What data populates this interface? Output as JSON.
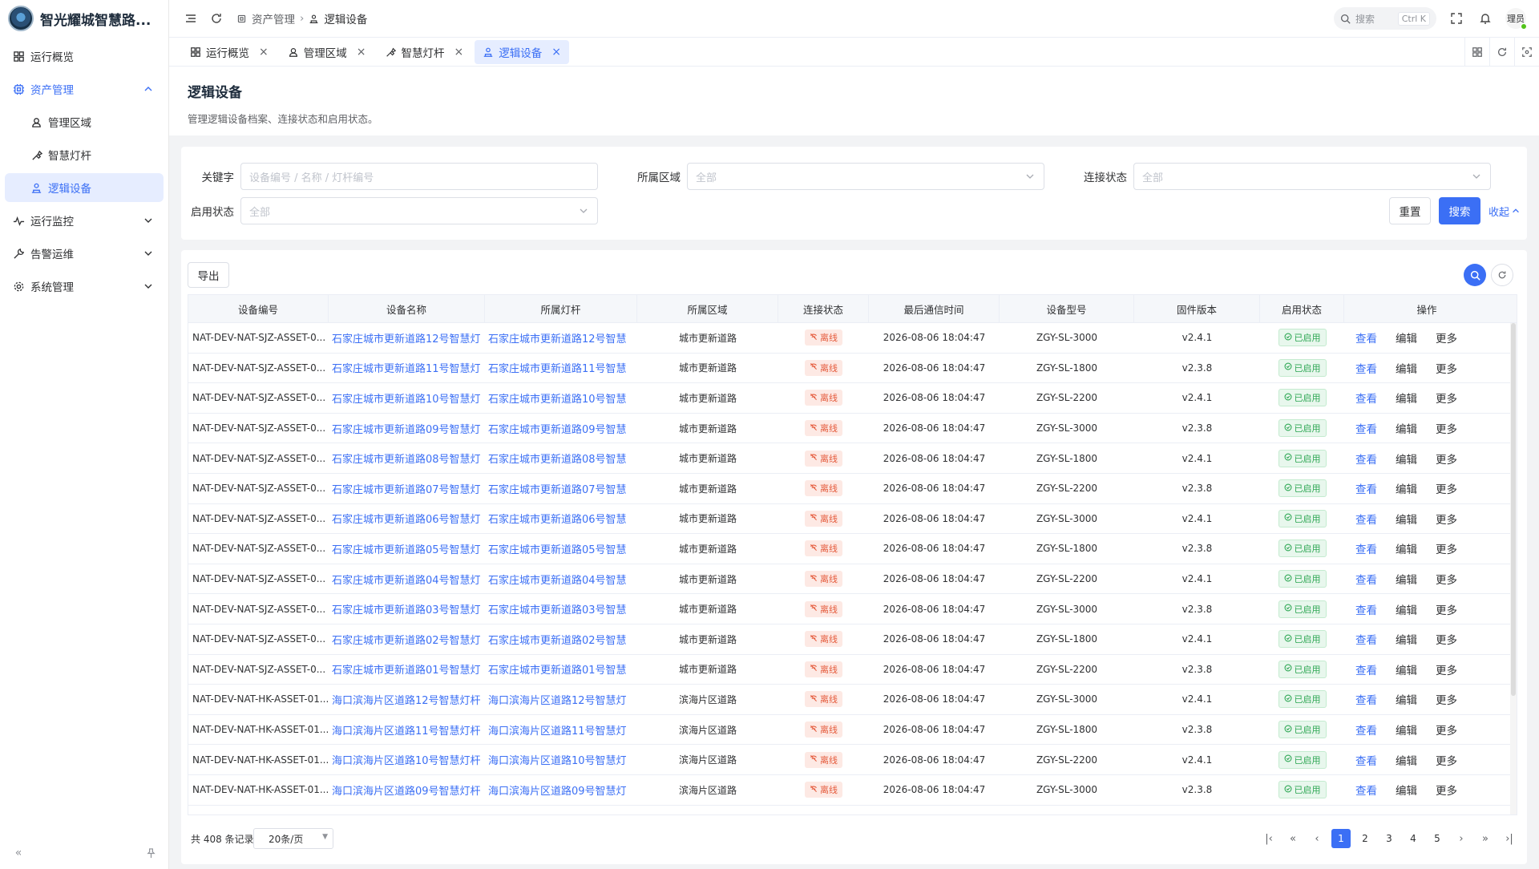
{
  "app": {
    "title": "智光耀城智慧路..."
  },
  "sidebar": {
    "items": [
      {
        "label": "运行概览",
        "icon": "grid-icon"
      },
      {
        "label": "资产管理",
        "icon": "asset-icon"
      },
      {
        "label": "管理区域",
        "icon": "area-icon"
      },
      {
        "label": "智慧灯杆",
        "icon": "pole-icon"
      },
      {
        "label": "逻辑设备",
        "icon": "device-icon"
      },
      {
        "label": "运行监控",
        "icon": "monitor-icon"
      },
      {
        "label": "告警运维",
        "icon": "wrench-icon"
      },
      {
        "label": "系统管理",
        "icon": "gear-icon"
      }
    ]
  },
  "topbar": {
    "breadcrumb": [
      "资产管理",
      "逻辑设备"
    ],
    "search_label": "搜索",
    "search_shortcut": "Ctrl K",
    "user": "理员"
  },
  "tabs": [
    {
      "label": "运行概览"
    },
    {
      "label": "管理区域"
    },
    {
      "label": "智慧灯杆"
    },
    {
      "label": "逻辑设备"
    }
  ],
  "page": {
    "title": "逻辑设备",
    "desc": "管理逻辑设备档案、连接状态和启用状态。"
  },
  "filter": {
    "keyword_label": "关键字",
    "keyword_placeholder": "设备编号 / 名称 / 灯杆编号",
    "area_label": "所属区域",
    "area_value": "全部",
    "conn_label": "连接状态",
    "conn_value": "全部",
    "enable_label": "启用状态",
    "enable_value": "全部",
    "reset": "重置",
    "search": "搜索",
    "collapse": "收起"
  },
  "toolbar": {
    "export": "导出"
  },
  "table": {
    "headers": [
      "设备编号",
      "设备名称",
      "所属灯杆",
      "所属区域",
      "连接状态",
      "最后通信时间",
      "设备型号",
      "固件版本",
      "启用状态",
      "操作"
    ],
    "rows": [
      {
        "id": "NAT-DEV-NAT-SJZ-ASSET-0...",
        "name": "石家庄城市更新道路12号智慧灯",
        "pole": "石家庄城市更新道路12号智慧",
        "area": "城市更新道路",
        "conn": "离线",
        "time": "2026-08-06 18:04:47",
        "model": "ZGY-SL-3000",
        "fw": "v2.4.1",
        "enable": "已启用"
      },
      {
        "id": "NAT-DEV-NAT-SJZ-ASSET-0...",
        "name": "石家庄城市更新道路11号智慧灯",
        "pole": "石家庄城市更新道路11号智慧",
        "area": "城市更新道路",
        "conn": "离线",
        "time": "2026-08-06 18:04:47",
        "model": "ZGY-SL-1800",
        "fw": "v2.3.8",
        "enable": "已启用"
      },
      {
        "id": "NAT-DEV-NAT-SJZ-ASSET-0...",
        "name": "石家庄城市更新道路10号智慧灯",
        "pole": "石家庄城市更新道路10号智慧",
        "area": "城市更新道路",
        "conn": "离线",
        "time": "2026-08-06 18:04:47",
        "model": "ZGY-SL-2200",
        "fw": "v2.4.1",
        "enable": "已启用"
      },
      {
        "id": "NAT-DEV-NAT-SJZ-ASSET-0...",
        "name": "石家庄城市更新道路09号智慧灯",
        "pole": "石家庄城市更新道路09号智慧",
        "area": "城市更新道路",
        "conn": "离线",
        "time": "2026-08-06 18:04:47",
        "model": "ZGY-SL-3000",
        "fw": "v2.3.8",
        "enable": "已启用"
      },
      {
        "id": "NAT-DEV-NAT-SJZ-ASSET-0...",
        "name": "石家庄城市更新道路08号智慧灯",
        "pole": "石家庄城市更新道路08号智慧",
        "area": "城市更新道路",
        "conn": "离线",
        "time": "2026-08-06 18:04:47",
        "model": "ZGY-SL-1800",
        "fw": "v2.4.1",
        "enable": "已启用"
      },
      {
        "id": "NAT-DEV-NAT-SJZ-ASSET-0...",
        "name": "石家庄城市更新道路07号智慧灯",
        "pole": "石家庄城市更新道路07号智慧",
        "area": "城市更新道路",
        "conn": "离线",
        "time": "2026-08-06 18:04:47",
        "model": "ZGY-SL-2200",
        "fw": "v2.3.8",
        "enable": "已启用"
      },
      {
        "id": "NAT-DEV-NAT-SJZ-ASSET-0...",
        "name": "石家庄城市更新道路06号智慧灯",
        "pole": "石家庄城市更新道路06号智慧",
        "area": "城市更新道路",
        "conn": "离线",
        "time": "2026-08-06 18:04:47",
        "model": "ZGY-SL-3000",
        "fw": "v2.4.1",
        "enable": "已启用"
      },
      {
        "id": "NAT-DEV-NAT-SJZ-ASSET-0...",
        "name": "石家庄城市更新道路05号智慧灯",
        "pole": "石家庄城市更新道路05号智慧",
        "area": "城市更新道路",
        "conn": "离线",
        "time": "2026-08-06 18:04:47",
        "model": "ZGY-SL-1800",
        "fw": "v2.3.8",
        "enable": "已启用"
      },
      {
        "id": "NAT-DEV-NAT-SJZ-ASSET-0...",
        "name": "石家庄城市更新道路04号智慧灯",
        "pole": "石家庄城市更新道路04号智慧",
        "area": "城市更新道路",
        "conn": "离线",
        "time": "2026-08-06 18:04:47",
        "model": "ZGY-SL-2200",
        "fw": "v2.4.1",
        "enable": "已启用"
      },
      {
        "id": "NAT-DEV-NAT-SJZ-ASSET-0...",
        "name": "石家庄城市更新道路03号智慧灯",
        "pole": "石家庄城市更新道路03号智慧",
        "area": "城市更新道路",
        "conn": "离线",
        "time": "2026-08-06 18:04:47",
        "model": "ZGY-SL-3000",
        "fw": "v2.3.8",
        "enable": "已启用"
      },
      {
        "id": "NAT-DEV-NAT-SJZ-ASSET-0...",
        "name": "石家庄城市更新道路02号智慧灯",
        "pole": "石家庄城市更新道路02号智慧",
        "area": "城市更新道路",
        "conn": "离线",
        "time": "2026-08-06 18:04:47",
        "model": "ZGY-SL-1800",
        "fw": "v2.4.1",
        "enable": "已启用"
      },
      {
        "id": "NAT-DEV-NAT-SJZ-ASSET-0...",
        "name": "石家庄城市更新道路01号智慧灯",
        "pole": "石家庄城市更新道路01号智慧",
        "area": "城市更新道路",
        "conn": "离线",
        "time": "2026-08-06 18:04:47",
        "model": "ZGY-SL-2200",
        "fw": "v2.3.8",
        "enable": "已启用"
      },
      {
        "id": "NAT-DEV-NAT-HK-ASSET-01...",
        "name": "海口滨海片区道路12号智慧灯杆",
        "pole": "海口滨海片区道路12号智慧灯",
        "area": "滨海片区道路",
        "conn": "离线",
        "time": "2026-08-06 18:04:47",
        "model": "ZGY-SL-3000",
        "fw": "v2.4.1",
        "enable": "已启用"
      },
      {
        "id": "NAT-DEV-NAT-HK-ASSET-01...",
        "name": "海口滨海片区道路11号智慧灯杆",
        "pole": "海口滨海片区道路11号智慧灯",
        "area": "滨海片区道路",
        "conn": "离线",
        "time": "2026-08-06 18:04:47",
        "model": "ZGY-SL-1800",
        "fw": "v2.3.8",
        "enable": "已启用"
      },
      {
        "id": "NAT-DEV-NAT-HK-ASSET-01...",
        "name": "海口滨海片区道路10号智慧灯杆",
        "pole": "海口滨海片区道路10号智慧灯",
        "area": "滨海片区道路",
        "conn": "离线",
        "time": "2026-08-06 18:04:47",
        "model": "ZGY-SL-2200",
        "fw": "v2.4.1",
        "enable": "已启用"
      },
      {
        "id": "NAT-DEV-NAT-HK-ASSET-01...",
        "name": "海口滨海片区道路09号智慧灯杆",
        "pole": "海口滨海片区道路09号智慧灯",
        "area": "滨海片区道路",
        "conn": "离线",
        "time": "2026-08-06 18:04:47",
        "model": "ZGY-SL-3000",
        "fw": "v2.3.8",
        "enable": "已启用"
      }
    ],
    "ops": {
      "view": "查看",
      "edit": "编辑",
      "more": "更多"
    }
  },
  "pager": {
    "total": "共 408 条记录",
    "pagesize": "20条/页",
    "pages": [
      "1",
      "2",
      "3",
      "4",
      "5"
    ]
  },
  "colors": {
    "primary": "#3b6ff5",
    "offline": "#e55b3c",
    "enabled": "#2ea754"
  }
}
